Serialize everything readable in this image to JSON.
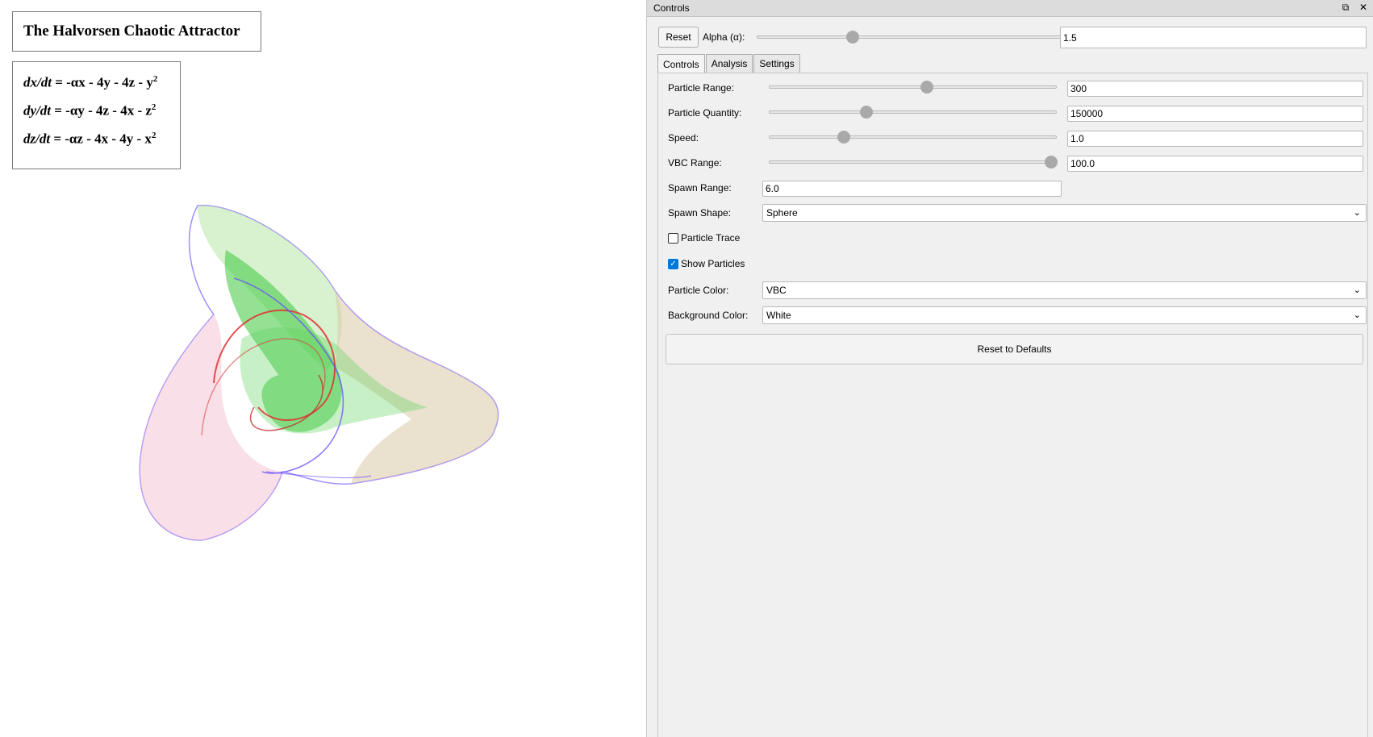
{
  "viewport": {
    "title": "The Halvorsen Chaotic Attractor",
    "equations": [
      {
        "lhs": "dx/dt",
        "rhs": "= -αx - 4y - 4z - y",
        "sup": "2"
      },
      {
        "lhs": "dy/dt",
        "rhs": "= -αy - 4z - 4x - z",
        "sup": "2"
      },
      {
        "lhs": "dz/dt",
        "rhs": "= -αz - 4x - 4y - x",
        "sup": "2"
      }
    ]
  },
  "panel": {
    "title": "Controls",
    "icons": {
      "float": "restore-icon",
      "close": "close-icon"
    },
    "reset_label": "Reset",
    "alpha_label": "Alpha (α):",
    "alpha_value": "1.5",
    "alpha_slider": 0.31,
    "tabs": [
      "Controls",
      "Analysis",
      "Settings"
    ],
    "active_tab": "Controls",
    "controls": {
      "particle_range": {
        "label": "Particle Range:",
        "value": "300",
        "slider": 0.55
      },
      "particle_quantity": {
        "label": "Particle Quantity:",
        "value": "150000",
        "slider": 0.34
      },
      "speed": {
        "label": "Speed:",
        "value": "1.0",
        "slider": 0.26
      },
      "vbc_range": {
        "label": "VBC Range:",
        "value": "100.0",
        "slider": 0.98
      },
      "spawn_range": {
        "label": "Spawn Range:",
        "value": "6.0"
      },
      "spawn_shape": {
        "label": "Spawn Shape:",
        "value": "Sphere"
      },
      "particle_trace": {
        "label": "Particle Trace",
        "checked": false
      },
      "show_particles": {
        "label": "Show Particles",
        "checked": true
      },
      "particle_color": {
        "label": "Particle Color:",
        "value": "VBC"
      },
      "background_color": {
        "label": "Background Color:",
        "value": "White"
      },
      "reset_defaults": "Reset to Defaults"
    }
  },
  "colors": {
    "accent": "#0078d7",
    "attractor_green": "#3cc83c",
    "attractor_red": "#e03030",
    "attractor_blue": "#6a4cff"
  }
}
